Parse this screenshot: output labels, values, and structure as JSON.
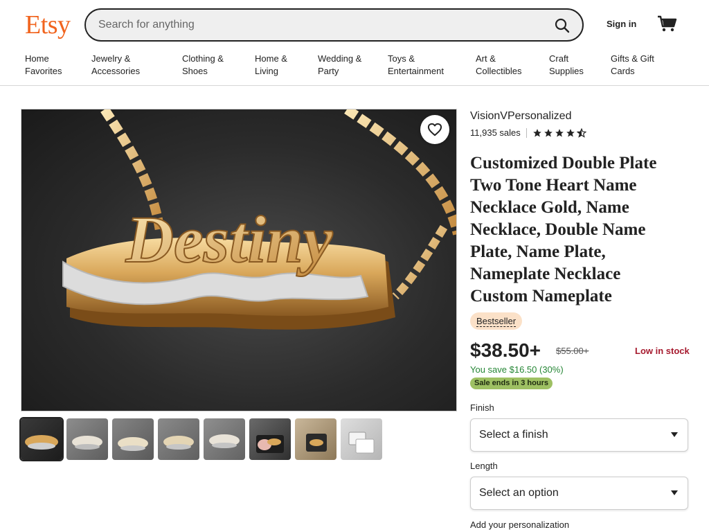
{
  "header": {
    "logo": "Etsy",
    "search_placeholder": "Search for anything",
    "search_icon": "search-icon",
    "signin_label": "Sign in",
    "cart_icon": "cart-icon",
    "brand_color": "#f1641e"
  },
  "nav": [
    {
      "line1": "Home",
      "line2": "Favorites"
    },
    {
      "line1": "Jewelry &",
      "line2": "Accessories"
    },
    {
      "line1": "Clothing &",
      "line2": "Shoes"
    },
    {
      "line1": "Home &",
      "line2": "Living"
    },
    {
      "line1": "Wedding &",
      "line2": "Party"
    },
    {
      "line1": "Toys &",
      "line2": "Entertainment"
    },
    {
      "line1": "Art &",
      "line2": "Collectibles"
    },
    {
      "line1": "Craft",
      "line2": "Supplies"
    },
    {
      "line1": "Gifts & Gift",
      "line2": "Cards"
    }
  ],
  "gallery": {
    "main_image_text": "Destiny",
    "favorite_icon": "heart-icon",
    "thumbnail_count": 8,
    "active_thumbnail": 1
  },
  "listing": {
    "shop_name": "VisionVPersonalized",
    "sales": "11,935 sales",
    "rating": 4.5,
    "title": "Customized Double Plate Two Tone Heart Name Necklace Gold, Name Necklace, Double Name Plate, Name Plate, Nameplate Necklace Custom Nameplate",
    "badge": "Bestseller",
    "price": "$38.50+",
    "original_price": "$55.00+",
    "stock_status": "Low in stock",
    "savings": "You save $16.50 (30%)",
    "sale_ends": "Sale ends in 3 hours",
    "finish_label": "Finish",
    "finish_value": "Select a finish",
    "length_label": "Length",
    "length_value": "Select an option",
    "personalization_label": "Add your personalization"
  }
}
